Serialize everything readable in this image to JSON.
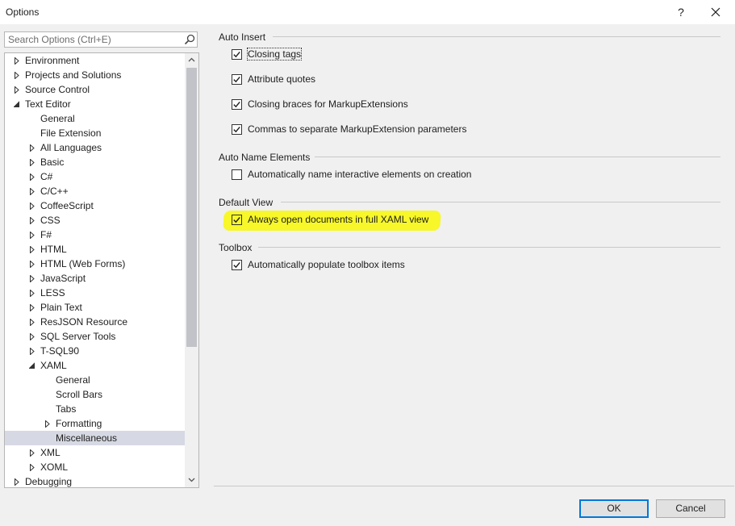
{
  "window": {
    "title": "Options",
    "help": "?"
  },
  "search": {
    "placeholder": "Search Options (Ctrl+E)"
  },
  "tree": {
    "items": [
      {
        "label": "Environment",
        "state": "collapsed",
        "level": 0
      },
      {
        "label": "Projects and Solutions",
        "state": "collapsed",
        "level": 0
      },
      {
        "label": "Source Control",
        "state": "collapsed",
        "level": 0
      },
      {
        "label": "Text Editor",
        "state": "expanded",
        "level": 0
      },
      {
        "label": "General",
        "state": "leaf",
        "level": 1
      },
      {
        "label": "File Extension",
        "state": "leaf",
        "level": 1
      },
      {
        "label": "All Languages",
        "state": "collapsed",
        "level": 1
      },
      {
        "label": "Basic",
        "state": "collapsed",
        "level": 1
      },
      {
        "label": "C#",
        "state": "collapsed",
        "level": 1
      },
      {
        "label": "C/C++",
        "state": "collapsed",
        "level": 1
      },
      {
        "label": "CoffeeScript",
        "state": "collapsed",
        "level": 1
      },
      {
        "label": "CSS",
        "state": "collapsed",
        "level": 1
      },
      {
        "label": "F#",
        "state": "collapsed",
        "level": 1
      },
      {
        "label": "HTML",
        "state": "collapsed",
        "level": 1
      },
      {
        "label": "HTML (Web Forms)",
        "state": "collapsed",
        "level": 1
      },
      {
        "label": "JavaScript",
        "state": "collapsed",
        "level": 1
      },
      {
        "label": "LESS",
        "state": "collapsed",
        "level": 1
      },
      {
        "label": "Plain Text",
        "state": "collapsed",
        "level": 1
      },
      {
        "label": "ResJSON Resource",
        "state": "collapsed",
        "level": 1
      },
      {
        "label": "SQL Server Tools",
        "state": "collapsed",
        "level": 1
      },
      {
        "label": "T-SQL90",
        "state": "collapsed",
        "level": 1
      },
      {
        "label": "XAML",
        "state": "expanded",
        "level": 1
      },
      {
        "label": "General",
        "state": "leaf",
        "level": 2
      },
      {
        "label": "Scroll Bars",
        "state": "leaf",
        "level": 2
      },
      {
        "label": "Tabs",
        "state": "leaf",
        "level": 2
      },
      {
        "label": "Formatting",
        "state": "collapsed",
        "level": 2
      },
      {
        "label": "Miscellaneous",
        "state": "leaf",
        "level": 2,
        "selected": true
      },
      {
        "label": "XML",
        "state": "collapsed",
        "level": 1
      },
      {
        "label": "XOML",
        "state": "collapsed",
        "level": 1
      },
      {
        "label": "Debugging",
        "state": "collapsed",
        "level": 0
      }
    ]
  },
  "sections": {
    "auto_insert": {
      "title": "Auto Insert",
      "options": [
        {
          "label": "Closing tags",
          "checked": true
        },
        {
          "label": "Attribute quotes",
          "checked": true
        },
        {
          "label": "Closing braces for MarkupExtensions",
          "checked": true
        },
        {
          "label": "Commas to separate MarkupExtension parameters",
          "checked": true
        }
      ]
    },
    "auto_name": {
      "title": "Auto Name Elements",
      "options": [
        {
          "label": "Automatically name interactive elements on creation",
          "checked": false
        }
      ]
    },
    "default_view": {
      "title": "Default View",
      "options": [
        {
          "label": "Always open documents in full XAML view",
          "checked": true
        }
      ]
    },
    "toolbox": {
      "title": "Toolbox",
      "options": [
        {
          "label": "Automatically populate toolbox items",
          "checked": true
        }
      ]
    }
  },
  "buttons": {
    "ok": "OK",
    "cancel": "Cancel"
  },
  "colors": {
    "highlight": "#f7f72a",
    "selection": "#d6d9e3",
    "ok_border": "#0078d7"
  }
}
